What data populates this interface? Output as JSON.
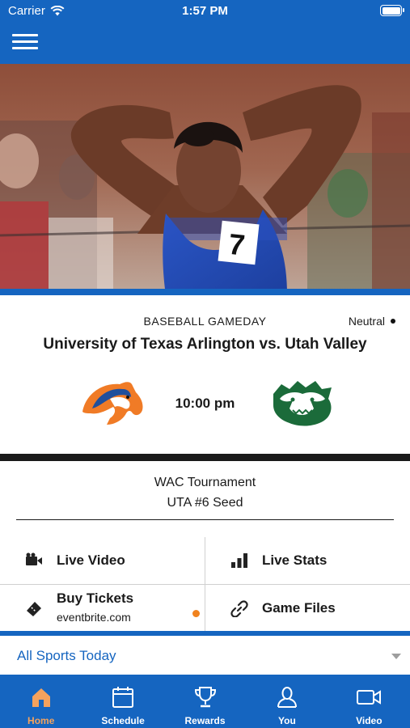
{
  "status_bar": {
    "carrier": "Carrier",
    "time": "1:57 PM"
  },
  "game": {
    "sport_label": "BASEBALL GAMEDAY",
    "venue_type": "Neutral",
    "matchup": "University of Texas Arlington vs. Utah Valley",
    "time": "10:00 pm",
    "home_logo_icon": "maverick-horse-logo",
    "away_logo_icon": "wolverine-logo"
  },
  "tournament": {
    "name": "WAC Tournament",
    "seed": "UTA #6 Seed"
  },
  "actions": {
    "live_video": "Live Video",
    "live_stats": "Live Stats",
    "buy_tickets": "Buy Tickets",
    "buy_tickets_sub": "eventbrite.com",
    "game_files": "Game Files"
  },
  "sports_filter": {
    "selected": "All Sports Today"
  },
  "tabs": [
    {
      "label": "Home",
      "icon": "home-icon",
      "active": true
    },
    {
      "label": "Schedule",
      "icon": "calendar-icon",
      "active": false
    },
    {
      "label": "Rewards",
      "icon": "trophy-icon",
      "active": false
    },
    {
      "label": "You",
      "icon": "person-icon",
      "active": false
    },
    {
      "label": "Video",
      "icon": "video-camera-icon",
      "active": false
    }
  ],
  "colors": {
    "primary": "#1565c0",
    "accent_orange": "#f5a25d",
    "dot_orange": "#f0821e",
    "away_green": "#1b6b3a"
  }
}
